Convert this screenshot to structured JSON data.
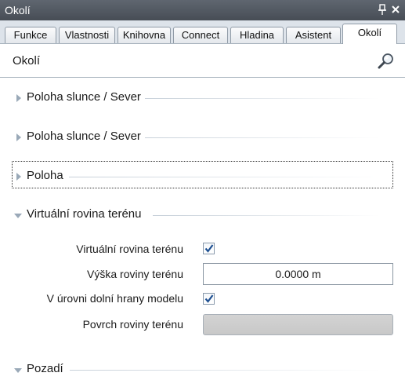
{
  "window": {
    "title": "Okolí"
  },
  "tabs": [
    {
      "label": "Funkce"
    },
    {
      "label": "Vlastnosti"
    },
    {
      "label": "Knihovna"
    },
    {
      "label": "Connect"
    },
    {
      "label": "Hladina"
    },
    {
      "label": "Asistent"
    },
    {
      "label": "Okolí",
      "active": true
    }
  ],
  "panel": {
    "title": "Okolí",
    "search_icon": "magnifier-icon"
  },
  "sections": [
    {
      "label": "Poloha slunce / Sever",
      "expanded": false
    },
    {
      "label": "Poloha slunce / Sever",
      "expanded": false
    },
    {
      "label": "Poloha",
      "expanded": false
    },
    {
      "label": "Virtuální rovina terénu",
      "expanded": true
    },
    {
      "label": "Pozadí",
      "expanded": true
    }
  ],
  "properties": {
    "virtual_plane": {
      "label": "Virtuální rovina terénu",
      "checked": true
    },
    "plane_height": {
      "label": "Výška roviny terénu",
      "value": "0.0000 m"
    },
    "bottom_edge": {
      "label": "V úrovni dolní hrany modelu",
      "checked": true
    },
    "surface": {
      "label": "Povrch roviny terénu",
      "color": "#cfcfcf"
    }
  },
  "colors": {
    "titlebar": "#515861",
    "tabstrip": "#dde3ea",
    "check": "#1d4f91"
  }
}
